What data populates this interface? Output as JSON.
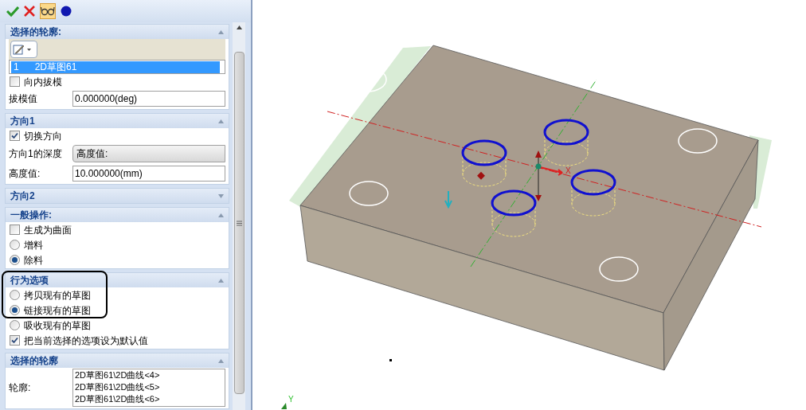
{
  "toolbar": [
    {
      "kind": "ok"
    },
    {
      "kind": "cancel"
    },
    {
      "kind": "preview",
      "selected": true
    },
    {
      "kind": "dot"
    }
  ],
  "sections": [
    {
      "title": "选择的轮廓:",
      "expanded": true,
      "rows": [
        {
          "kind": "picker"
        },
        {
          "kind": "list",
          "items": [
            {
              "index": "1",
              "text": "2D草图61",
              "selected": true
            }
          ]
        },
        {
          "kind": "checkbox",
          "label": "向内拔模",
          "checked": false
        },
        {
          "kind": "field",
          "label": "拔模值",
          "value": "0.000000(deg)"
        }
      ]
    },
    {
      "title": "方向1",
      "expanded": true,
      "rows": [
        {
          "kind": "checkbox",
          "label": "切换方向",
          "checked": true
        },
        {
          "kind": "dropdown",
          "label": "方向1的深度",
          "value": "高度值:"
        },
        {
          "kind": "field",
          "label": "高度值:",
          "value": "10.000000(mm)"
        }
      ]
    },
    {
      "title": "方向2",
      "expanded": false
    },
    {
      "title": "一般操作:",
      "expanded": true,
      "rows": [
        {
          "kind": "checkbox",
          "label": "生成为曲面",
          "checked": false
        },
        {
          "kind": "radio",
          "label": "增料",
          "selected": false
        },
        {
          "kind": "radio",
          "label": "除料",
          "selected": true
        }
      ]
    },
    {
      "title": "行为选项",
      "expanded": true,
      "highlighted_rows": [
        {
          "kind": "radio",
          "label": "拷贝现有的草图",
          "selected": false
        },
        {
          "kind": "radio",
          "label": "链接现有的草图",
          "selected": true
        }
      ],
      "rows": [
        {
          "kind": "radio",
          "label": "吸收现有的草图",
          "selected": false
        },
        {
          "kind": "checkbox",
          "label": "把当前选择的选项设为默认值",
          "checked": true
        }
      ]
    },
    {
      "title": "选择的轮廓",
      "expanded": true,
      "rows": [
        {
          "kind": "textlist",
          "label": "轮廓:",
          "lines": [
            "2D草图61\\2D曲线<4>",
            "2D草图61\\2D曲线<5>",
            "2D草图61\\2D曲线<6>"
          ]
        }
      ]
    }
  ],
  "viewport": {
    "axis_labels": [
      {
        "text": "X",
        "kind": "x"
      },
      {
        "text": "Y",
        "kind": "y"
      }
    ]
  }
}
